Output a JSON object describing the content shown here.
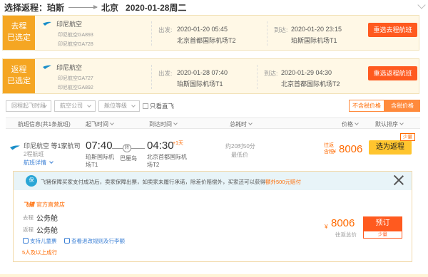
{
  "header": {
    "prefix": "选择返程：",
    "from_city": "珀斯",
    "to_city": "北京",
    "date": "2020-01-28周二"
  },
  "outbound": {
    "tag_line1": "去程",
    "tag_line2": "已选定",
    "airline": "印尼航空",
    "flights": [
      "印尼航空GA893",
      "印尼航空GA728"
    ],
    "depart_label": "出发:",
    "depart_time": "2020-01-20 05:45",
    "depart_airport": "北京首都国际机场T2",
    "arrive_label": "到达:",
    "arrive_time": "2020-01-20 23:15",
    "arrive_airport": "珀斯国际机场T1",
    "reselect_label": "重选去程航班"
  },
  "inbound": {
    "tag_line1": "返程",
    "tag_line2": "已选定",
    "airline": "印尼航空",
    "flights": [
      "印尼航空GA727",
      "印尼航空GA892"
    ],
    "depart_label": "出发:",
    "depart_time": "2020-01-28 07:40",
    "depart_airport": "珀斯国际机场T1",
    "arrive_label": "到达:",
    "arrive_time": "2020-01-29 04:30",
    "arrive_airport": "北京首都国际机场T2",
    "reselect_label": "重选返程航班"
  },
  "filters": {
    "dropdowns": [
      "回程起飞时段",
      "航空公司",
      "舱位等级"
    ],
    "direct_only": "只看直飞",
    "price_toggle": [
      "不含税价格",
      "含税价格"
    ],
    "price_toggle_active": 1
  },
  "columns": {
    "flight_info": "航班信息(共1条航班)",
    "depart_time": "起飞时间",
    "arrive_time": "到达时间",
    "duration": "总耗时",
    "price": "价格",
    "sort": "默认排序"
  },
  "result": {
    "airline_line": "印尼航空 等1家航司",
    "segments": "2程航班",
    "detail_link": "航班详情",
    "depart_time": "07:40",
    "depart_airport_1": "珀斯国际机",
    "depart_airport_2": "场T1",
    "via_icon": "转",
    "via_city": "巴厘岛",
    "arrive_time": "04:30",
    "day_offset": "+1天",
    "arrive_airport_1": "北京首都国际机",
    "arrive_airport_2": "场T2",
    "duration": "约20时50分",
    "tip": "最低价",
    "price_label_1": "往返",
    "price_label_2": "含税",
    "currency": "¥",
    "price": "8006",
    "select_label": "选为返程",
    "few_label": "少量"
  },
  "detail": {
    "shield_text": "保",
    "notice_pre": "飞猪保障买家支付成功后，卖家保障出票，如卖家未履行承诺，除差价赔偿外，买家还可以获得",
    "notice_hl": "额外500元赔付",
    "store_brand": "飞猪",
    "store_name": "官方直营店",
    "go_label": "去程",
    "go_cabin": "公务舱",
    "return_label": "返程",
    "return_cabin": "公务舱",
    "svc_1": "支持儿童票",
    "svc_2": "查看退改规则及行李额",
    "min_note": "5人及以上成行",
    "currency": "¥",
    "price": "8006",
    "price_note": "往返总价",
    "book_label": "预订",
    "book_sub": "少量"
  },
  "colors": {
    "accent": "#ff5a1f",
    "tag": "#f5a623",
    "select_btn": "#ffc52e",
    "link": "#3a7fd5"
  }
}
